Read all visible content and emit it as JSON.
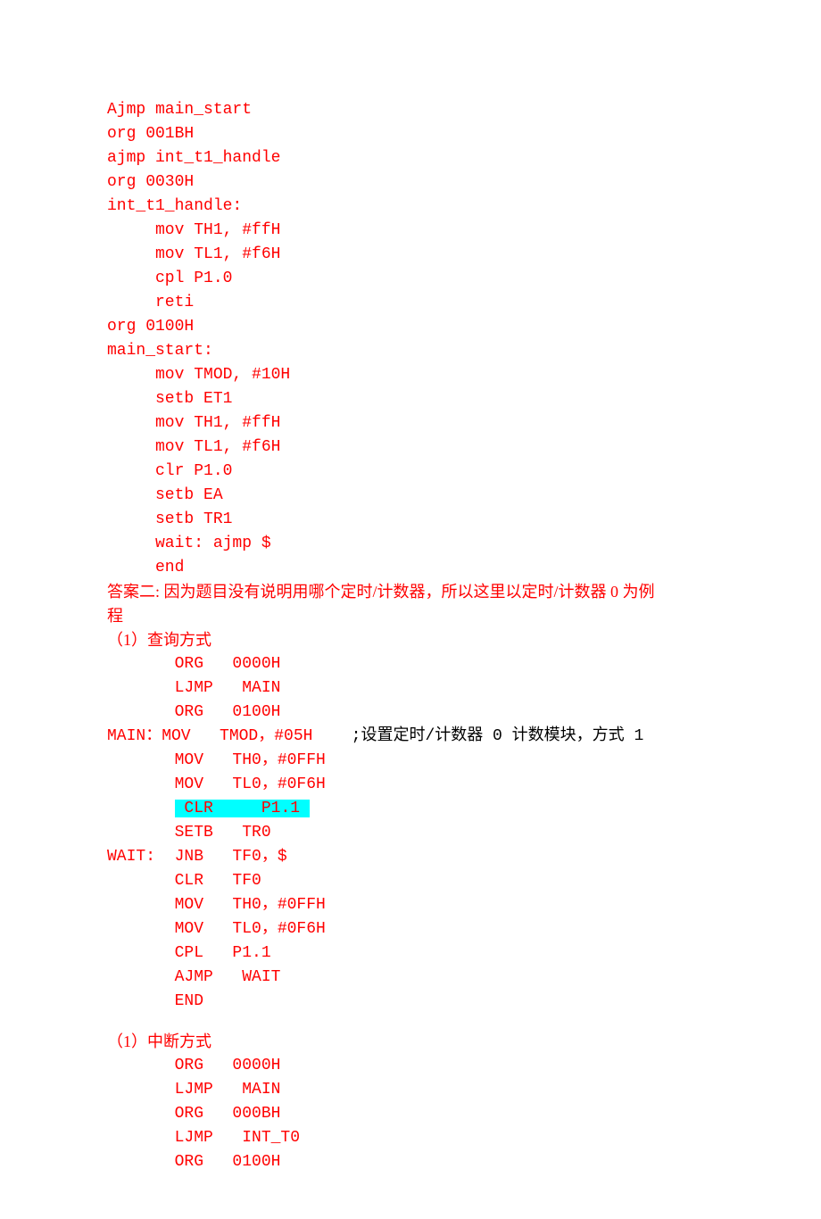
{
  "lines": [
    {
      "cls": "code-line red",
      "text": "Ajmp main_start"
    },
    {
      "cls": "code-line red",
      "text": "org 001BH"
    },
    {
      "cls": "code-line red",
      "text": "ajmp int_t1_handle"
    },
    {
      "cls": "code-line red",
      "text": "org 0030H"
    },
    {
      "cls": "code-line red",
      "text": "int_t1_handle:"
    },
    {
      "cls": "code-line red",
      "text": "     mov TH1, #ffH"
    },
    {
      "cls": "code-line red",
      "text": "     mov TL1, #f6H"
    },
    {
      "cls": "code-line red",
      "text": "     cpl P1.0"
    },
    {
      "cls": "code-line red",
      "text": "     reti"
    },
    {
      "cls": "code-line red",
      "text": "org 0100H"
    },
    {
      "cls": "code-line red",
      "text": "main_start:"
    },
    {
      "cls": "code-line red",
      "text": "     mov TMOD, #10H"
    },
    {
      "cls": "code-line red",
      "text": "     setb ET1"
    },
    {
      "cls": "code-line red",
      "text": "     mov TH1, #ffH"
    },
    {
      "cls": "code-line red",
      "text": "     mov TL1, #f6H"
    },
    {
      "cls": "code-line red",
      "text": "     clr P1.0"
    },
    {
      "cls": "code-line red",
      "text": "     setb EA"
    },
    {
      "cls": "code-line red",
      "text": "     setb TR1"
    },
    {
      "cls": "code-line red",
      "text": "     wait: ajmp $"
    },
    {
      "cls": "code-line red",
      "text": "     end"
    }
  ],
  "answer2": {
    "intro1": "答案二: 因为题目没有说明用哪个定时/计数器，所以这里以定时/计数器 0 为例",
    "intro2": "程",
    "sec1": "（1）查询方式"
  },
  "block2": [
    {
      "cls": "code-line red",
      "text": "       ORG   0000H"
    },
    {
      "cls": "code-line red",
      "text": "       LJMP   MAIN"
    },
    {
      "cls": "code-line red",
      "text": "       ORG   0100H"
    }
  ],
  "main_line": {
    "prefix_red": "MAIN：MOV   TMOD，#05H",
    "suffix_black": "    ;设置定时/计数器 0 计数模块，方式 1"
  },
  "block3": [
    {
      "cls": "code-line red",
      "text": "       MOV   TH0，#0FFH"
    },
    {
      "cls": "code-line red",
      "text": "       MOV   TL0，#0F6H"
    }
  ],
  "clr_line": {
    "pad": "       ",
    "hl": " CLR     P1.1 "
  },
  "block4": [
    {
      "cls": "code-line red",
      "text": "       SETB   TR0"
    },
    {
      "cls": "code-line red",
      "text": "WAIT:  JNB   TF0，$"
    },
    {
      "cls": "code-line red",
      "text": "       CLR   TF0"
    },
    {
      "cls": "code-line red",
      "text": "       MOV   TH0，#0FFH"
    },
    {
      "cls": "code-line red",
      "text": "       MOV   TL0，#0F6H"
    },
    {
      "cls": "code-line red",
      "text": "       CPL   P1.1"
    },
    {
      "cls": "code-line red",
      "text": "       AJMP   WAIT"
    },
    {
      "cls": "code-line red",
      "text": "       END"
    }
  ],
  "sec2": "（1）中断方式",
  "block5": [
    {
      "cls": "code-line red",
      "text": "       ORG   0000H"
    },
    {
      "cls": "code-line red",
      "text": "       LJMP   MAIN"
    },
    {
      "cls": "code-line red",
      "text": "       ORG   000BH"
    },
    {
      "cls": "code-line red",
      "text": "       LJMP   INT_T0"
    },
    {
      "cls": "code-line red",
      "text": "       ORG   0100H"
    }
  ]
}
